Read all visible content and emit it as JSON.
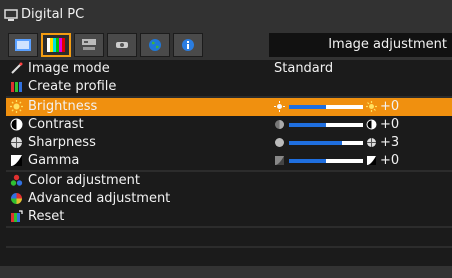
{
  "header": {
    "input_label": "Digital PC",
    "tab_title": "Image adjustment"
  },
  "tabs": [
    {
      "name": "display-tab",
      "icon": "monitor-icon"
    },
    {
      "name": "image-adjustment-tab",
      "icon": "color-bars-icon",
      "selected": true
    },
    {
      "name": "setup-tab",
      "icon": "projector-icon"
    },
    {
      "name": "remote-tab",
      "icon": "remote-icon"
    },
    {
      "name": "network-tab",
      "icon": "globe-icon"
    },
    {
      "name": "info-tab",
      "icon": "info-icon"
    }
  ],
  "menu": {
    "image_mode": {
      "label": "Image mode",
      "value": "Standard"
    },
    "create_profile": {
      "label": "Create profile"
    },
    "brightness": {
      "label": "Brightness",
      "value": "+0",
      "level": 0.5
    },
    "contrast": {
      "label": "Contrast",
      "value": "+0",
      "level": 0.5
    },
    "sharpness": {
      "label": "Sharpness",
      "value": "+3",
      "level": 0.72
    },
    "gamma": {
      "label": "Gamma",
      "value": "+0",
      "level": 0.5
    },
    "color_adjustment": {
      "label": "Color adjustment"
    },
    "advanced_adjustment": {
      "label": "Advanced adjustment"
    },
    "reset": {
      "label": "Reset"
    }
  },
  "colors": {
    "highlight": "#f0900f",
    "slider_fill": "#1f6fe0"
  }
}
